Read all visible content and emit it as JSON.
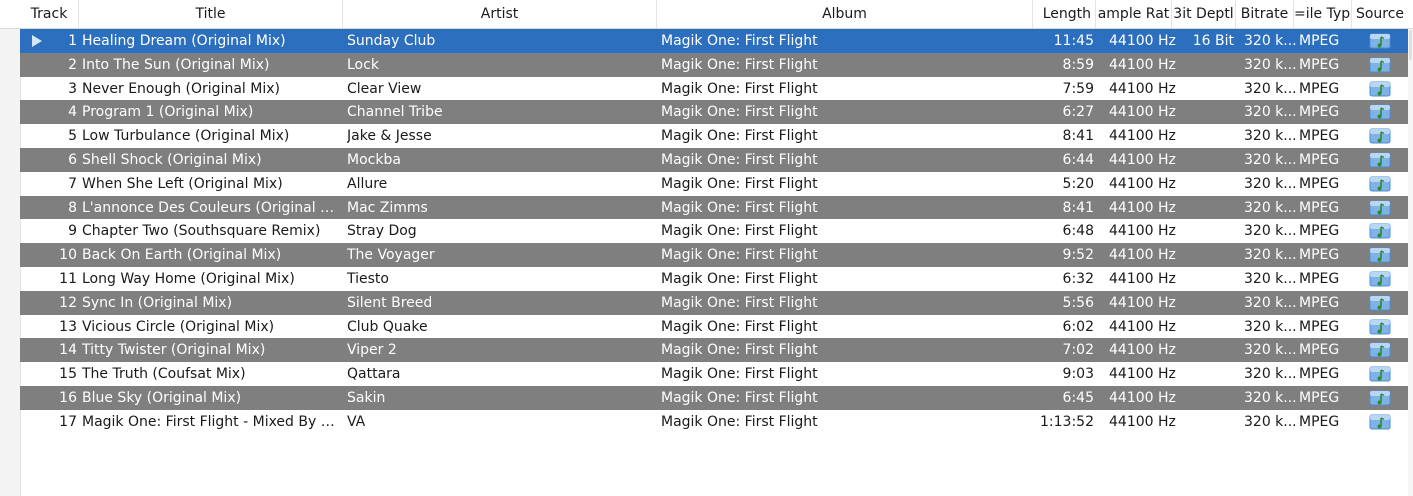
{
  "header": {
    "columns": {
      "track": "Track",
      "title": "Title",
      "artist": "Artist",
      "album": "Album",
      "length": "Length",
      "sample_rate": "ample Rat",
      "bit_depth": "3it Deptl",
      "bitrate": "Bitrate",
      "file_type": "=ile Type",
      "source": "Source"
    },
    "sort_icon": "chevron-down-icon"
  },
  "colors": {
    "selected_row": "#2c6fbe",
    "alternate_row": "#7f7f7f",
    "normal_row": "#ffffff",
    "source_icon": "#7fb3e8"
  },
  "tracks": [
    {
      "track": "1",
      "title": "Healing Dream (Original Mix)",
      "artist": "Sunday Club",
      "album": "Magik One: First Flight",
      "length": "11:45",
      "sample_rate": "44100 Hz",
      "bit_depth": "16 Bit",
      "bitrate": "320 k...",
      "file_type": "MPEG",
      "selected": true,
      "playing": true
    },
    {
      "track": "2",
      "title": "Into The Sun (Original Mix)",
      "artist": "Lock",
      "album": "Magik One: First Flight",
      "length": "8:59",
      "sample_rate": "44100 Hz",
      "bit_depth": "",
      "bitrate": "320 k...",
      "file_type": "MPEG"
    },
    {
      "track": "3",
      "title": "Never Enough (Original Mix)",
      "artist": "Clear View",
      "album": "Magik One: First Flight",
      "length": "7:59",
      "sample_rate": "44100 Hz",
      "bit_depth": "",
      "bitrate": "320 k...",
      "file_type": "MPEG"
    },
    {
      "track": "4",
      "title": "Program 1 (Original Mix)",
      "artist": "Channel Tribe",
      "album": "Magik One: First Flight",
      "length": "6:27",
      "sample_rate": "44100 Hz",
      "bit_depth": "",
      "bitrate": "320 k...",
      "file_type": "MPEG"
    },
    {
      "track": "5",
      "title": "Low Turbulance (Original Mix)",
      "artist": "Jake & Jesse",
      "album": "Magik One: First Flight",
      "length": "8:41",
      "sample_rate": "44100 Hz",
      "bit_depth": "",
      "bitrate": "320 k...",
      "file_type": "MPEG"
    },
    {
      "track": "6",
      "title": "Shell Shock (Original Mix)",
      "artist": "Mockba",
      "album": "Magik One: First Flight",
      "length": "6:44",
      "sample_rate": "44100 Hz",
      "bit_depth": "",
      "bitrate": "320 k...",
      "file_type": "MPEG"
    },
    {
      "track": "7",
      "title": "When She Left (Original Mix)",
      "artist": "Allure",
      "album": "Magik One: First Flight",
      "length": "5:20",
      "sample_rate": "44100 Hz",
      "bit_depth": "",
      "bitrate": "320 k...",
      "file_type": "MPEG"
    },
    {
      "track": "8",
      "title": "L'annonce Des Couleurs (Original Mix)",
      "artist": "Mac Zimms",
      "album": "Magik One: First Flight",
      "length": "8:41",
      "sample_rate": "44100 Hz",
      "bit_depth": "",
      "bitrate": "320 k...",
      "file_type": "MPEG"
    },
    {
      "track": "9",
      "title": "Chapter Two (Southsquare Remix)",
      "artist": "Stray Dog",
      "album": "Magik One: First Flight",
      "length": "6:48",
      "sample_rate": "44100 Hz",
      "bit_depth": "",
      "bitrate": "320 k...",
      "file_type": "MPEG"
    },
    {
      "track": "10",
      "title": "Back On Earth (Original Mix)",
      "artist": "The Voyager",
      "album": "Magik One: First Flight",
      "length": "9:52",
      "sample_rate": "44100 Hz",
      "bit_depth": "",
      "bitrate": "320 k...",
      "file_type": "MPEG"
    },
    {
      "track": "11",
      "title": "Long Way Home (Original Mix)",
      "artist": "Tiesto",
      "album": "Magik One: First Flight",
      "length": "6:32",
      "sample_rate": "44100 Hz",
      "bit_depth": "",
      "bitrate": "320 k...",
      "file_type": "MPEG"
    },
    {
      "track": "12",
      "title": "Sync In (Original Mix)",
      "artist": "Silent Breed",
      "album": "Magik One: First Flight",
      "length": "5:56",
      "sample_rate": "44100 Hz",
      "bit_depth": "",
      "bitrate": "320 k...",
      "file_type": "MPEG"
    },
    {
      "track": "13",
      "title": "Vicious Circle (Original Mix)",
      "artist": "Club Quake",
      "album": "Magik One: First Flight",
      "length": "6:02",
      "sample_rate": "44100 Hz",
      "bit_depth": "",
      "bitrate": "320 k...",
      "file_type": "MPEG"
    },
    {
      "track": "14",
      "title": "Titty Twister (Original Mix)",
      "artist": "Viper 2",
      "album": "Magik One: First Flight",
      "length": "7:02",
      "sample_rate": "44100 Hz",
      "bit_depth": "",
      "bitrate": "320 k...",
      "file_type": "MPEG"
    },
    {
      "track": "15",
      "title": "The Truth (Coufsat Mix)",
      "artist": "Qattara",
      "album": "Magik One: First Flight",
      "length": "9:03",
      "sample_rate": "44100 Hz",
      "bit_depth": "",
      "bitrate": "320 k...",
      "file_type": "MPEG"
    },
    {
      "track": "16",
      "title": "Blue Sky (Original Mix)",
      "artist": "Sakin",
      "album": "Magik One: First Flight",
      "length": "6:45",
      "sample_rate": "44100 Hz",
      "bit_depth": "",
      "bitrate": "320 k...",
      "file_type": "MPEG"
    },
    {
      "track": "17",
      "title": "Magik One: First Flight - Mixed By Ti...",
      "artist": "VA",
      "album": "Magik One: First Flight",
      "length": "1:13:52",
      "sample_rate": "44100 Hz",
      "bit_depth": "",
      "bitrate": "320 k...",
      "file_type": "MPEG"
    }
  ]
}
